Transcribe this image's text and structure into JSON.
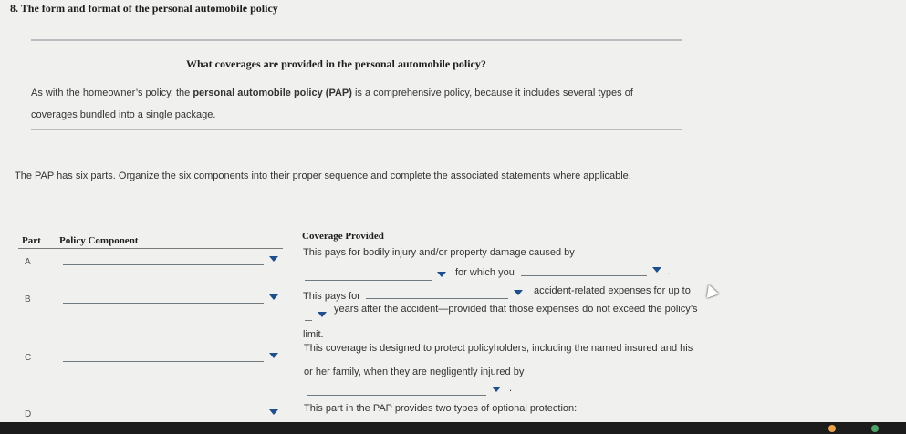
{
  "question": {
    "title": "8. The form and format of the personal automobile policy"
  },
  "section": {
    "heading": "What coverages are provided in the personal automobile policy?",
    "intro_pre": "As with the homeowner’s policy, the ",
    "intro_bold": "personal automobile policy (PAP)",
    "intro_post": " is a comprehensive policy, because it includes several types of",
    "intro_line2": "coverages bundled into a single package.",
    "instructions": "The PAP has six parts. Organize the six components into their proper sequence and complete the associated statements where applicable."
  },
  "table": {
    "col_part": "Part",
    "col_component": "Policy Component",
    "col_coverage": "Coverage Provided",
    "rows": [
      {
        "part": "A"
      },
      {
        "part": "B"
      },
      {
        "part": "C"
      },
      {
        "part": "D"
      }
    ],
    "a_line1": "This pays for bodily injury and/or property damage caused by",
    "a_line2": "for which you",
    "a_end": ".",
    "b_line1_pre": "This pays for",
    "b_line1_post": "accident-related expenses for up to",
    "b_line2": "years after the accident—provided that those expenses do not exceed the policy’s",
    "b_line3": "limit.",
    "c_line1": "This coverage is designed to protect policyholders, including the named insured and his",
    "c_line2": "or her family, when they are negligently injured by",
    "c_end": ".",
    "d_line1": "This part in the PAP provides two types of optional protection:"
  },
  "colors": {
    "accent": "#1f4e8c",
    "background": "#f0f0ee"
  }
}
